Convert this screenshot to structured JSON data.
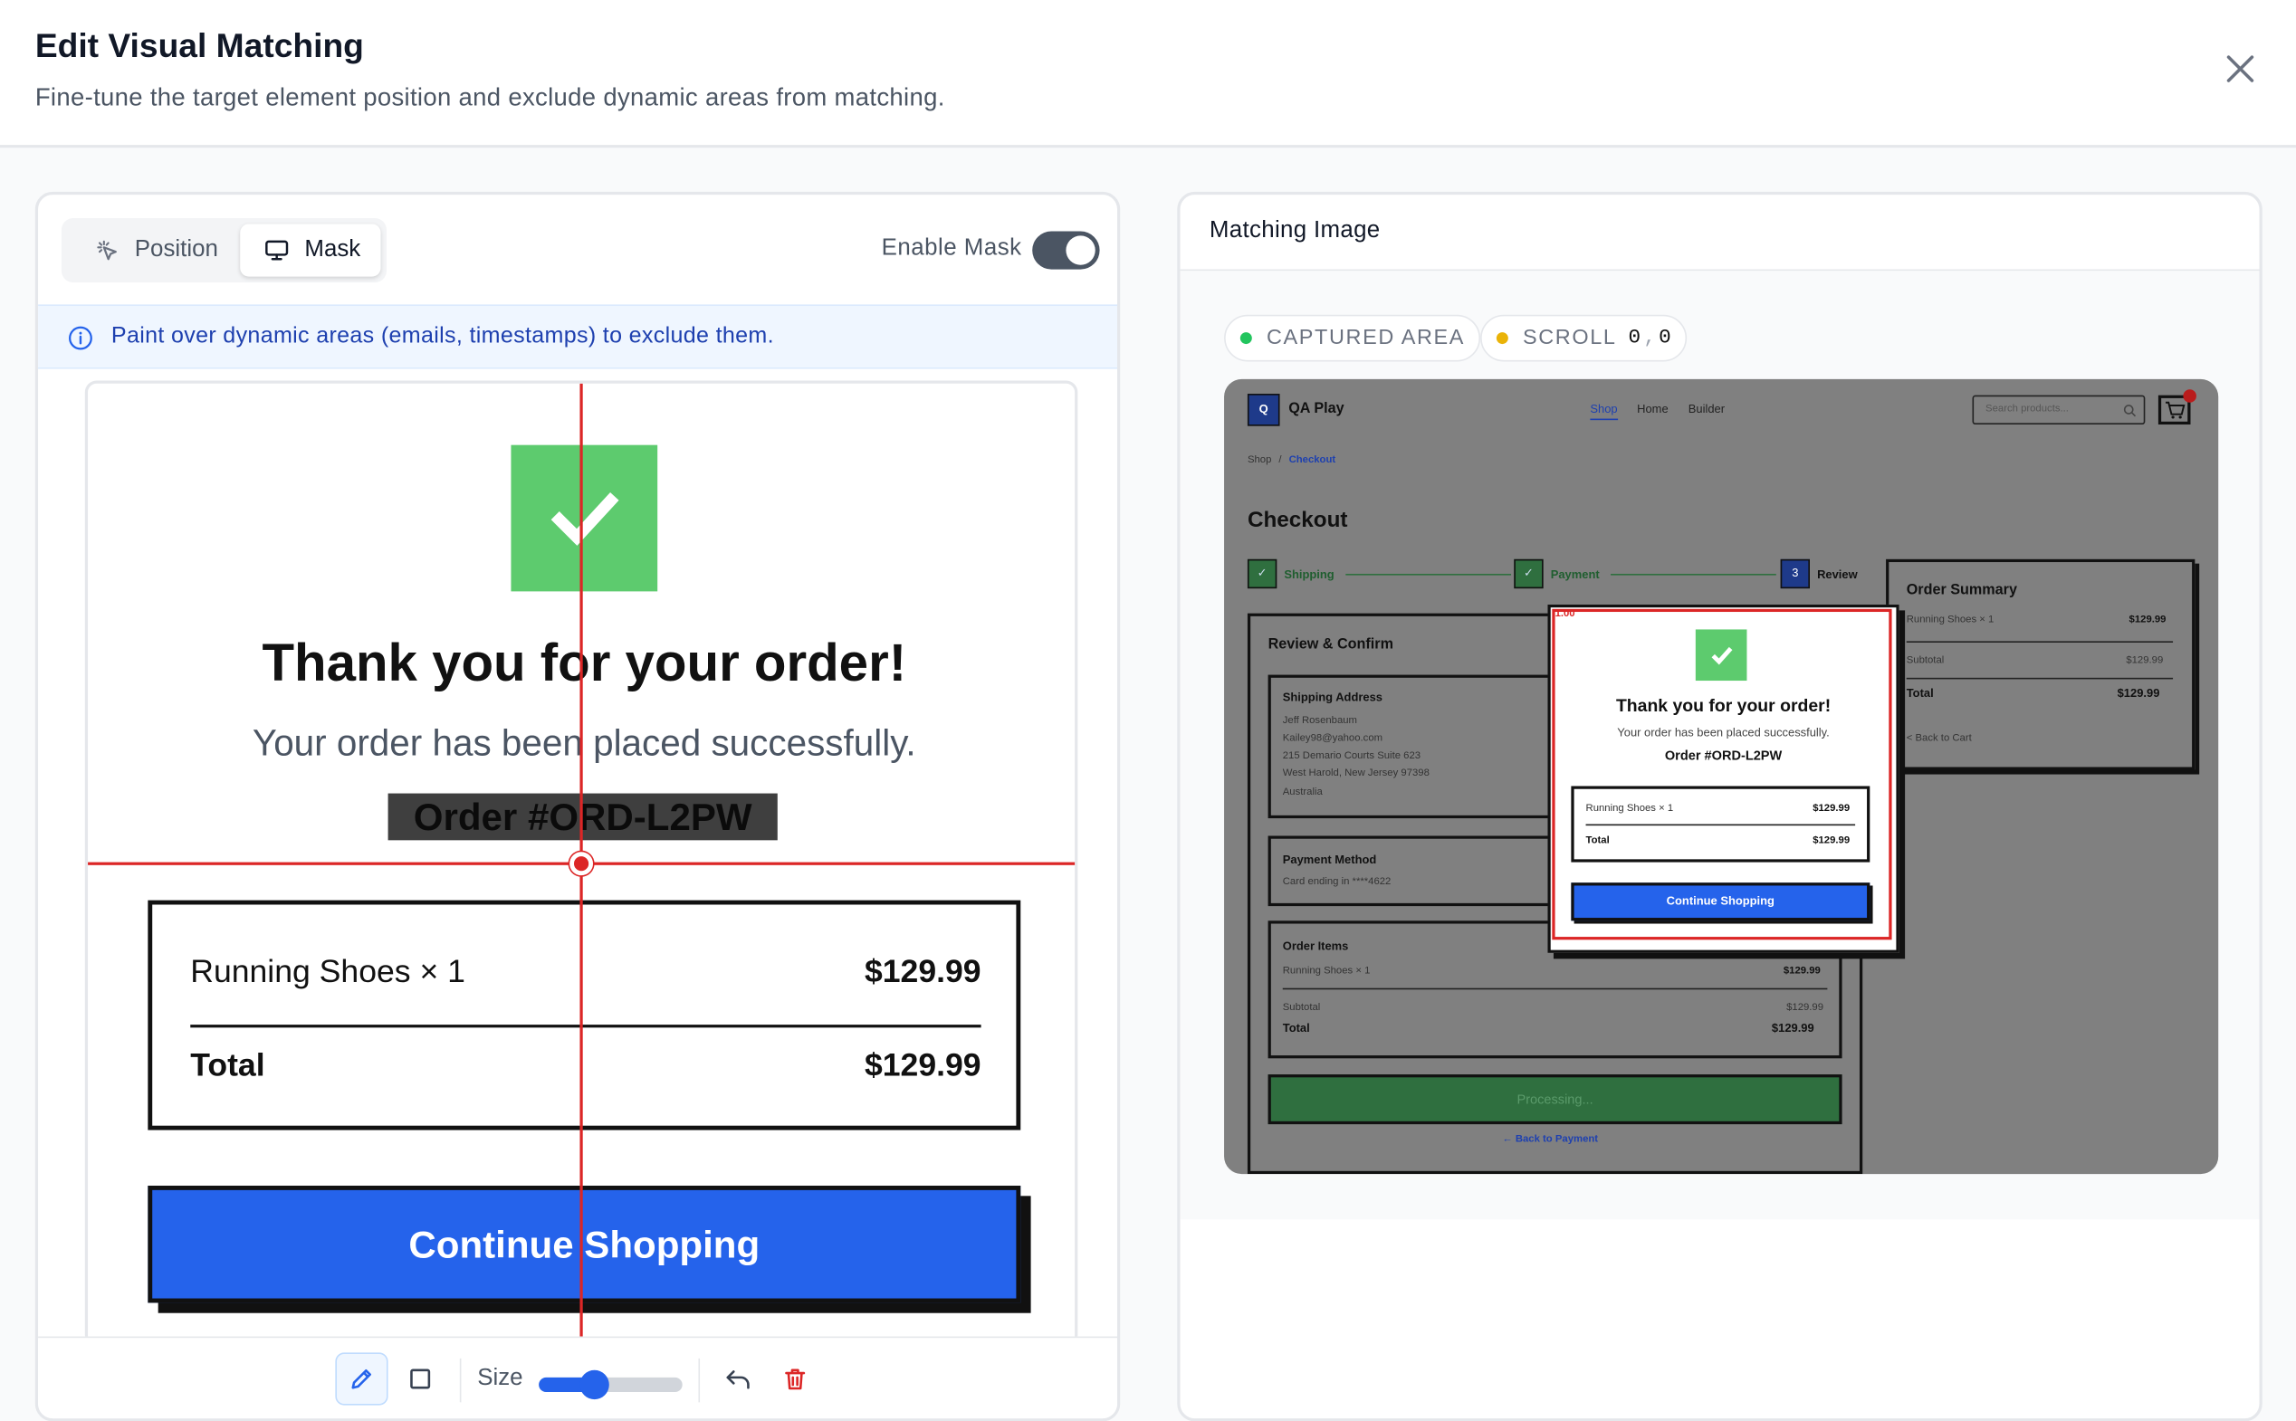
{
  "header": {
    "title": "Edit Visual Matching",
    "subtitle": "Fine-tune the target element position and exclude dynamic areas from matching."
  },
  "left": {
    "tabs": [
      {
        "label": "Position"
      },
      {
        "label": "Mask"
      }
    ],
    "enable_mask_label": "Enable Mask",
    "mask_enabled": true,
    "info_text": "Paint over dynamic areas (emails, timestamps) to exclude them.",
    "preview": {
      "title": "Thank you for your order!",
      "subtitle": "Your order has been placed successfully.",
      "order_number": "Order #ORD-L2PW",
      "item_label": "Running Shoes × 1",
      "item_price": "$129.99",
      "total_label": "Total",
      "total_price": "$129.99",
      "button_label": "Continue Shopping"
    },
    "toolbar": {
      "size_label": "Size",
      "size_value_fraction": 0.36
    }
  },
  "right": {
    "title": "Matching Image",
    "badges": {
      "captured": "CAPTURED AREA",
      "scroll": "SCROLL",
      "scroll_x": "0",
      "scroll_y": "0"
    },
    "screenshot": {
      "logo_letter": "Q",
      "brand": "QA Play",
      "nav": [
        "Shop",
        "Home",
        "Builder"
      ],
      "search_placeholder": "Search products...",
      "breadcrumb_root": "Shop",
      "breadcrumb_sep": "/",
      "breadcrumb_current": "Checkout",
      "page_title": "Checkout",
      "steps": [
        {
          "mark": "✓",
          "label": "Shipping"
        },
        {
          "mark": "✓",
          "label": "Payment"
        },
        {
          "mark": "3",
          "label": "Review"
        }
      ],
      "review_title": "Review & Confirm",
      "shipping_title": "Shipping Address",
      "shipping_lines": [
        "Jeff Rosenbaum",
        "Kailey98@yahoo.com",
        "215 Demario Courts Suite 623",
        "West Harold, New Jersey 97398",
        "Australia"
      ],
      "payment_title": "Payment Method",
      "payment_line": "Card ending in ****4622",
      "items_title": "Order Items",
      "item_label": "Running Shoes × 1",
      "item_price": "$129.99",
      "subtotal_label": "Subtotal",
      "subtotal_price": "$129.99",
      "total_label": "Total",
      "total_price": "$129.99",
      "processing_label": "Processing...",
      "back_link": "← Back to Payment",
      "summary_title": "Order Summary",
      "summary_item": "Running Shoes × 1",
      "summary_item_price": "$129.99",
      "summary_subtotal": "Subtotal",
      "summary_subtotal_price": "$129.99",
      "summary_total": "Total",
      "summary_total_price": "$129.99",
      "summary_back": "< Back to Cart",
      "match_score": "1.00",
      "modal": {
        "title": "Thank you for your order!",
        "subtitle": "Your order has been placed successfully.",
        "order_number": "Order #ORD-L2PW",
        "item_label": "Running Shoes × 1",
        "item_price": "$129.99",
        "total_label": "Total",
        "total_price": "$129.99",
        "button_label": "Continue Shopping"
      }
    }
  },
  "colors": {
    "accent": "#2563eb",
    "success": "#5dcb6e",
    "crosshair": "#dc2626",
    "captured_dot": "#22c55e",
    "scroll_dot": "#eab308"
  }
}
